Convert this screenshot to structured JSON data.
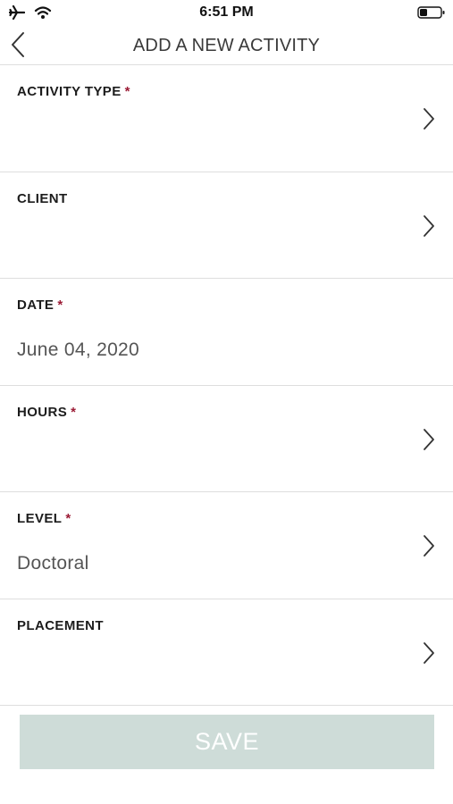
{
  "status_bar": {
    "time": "6:51 PM",
    "icons": [
      "airplane-icon",
      "wifi-icon",
      "battery-icon"
    ]
  },
  "nav": {
    "title": "ADD A NEW ACTIVITY",
    "back_icon": "chevron-left-icon"
  },
  "form": {
    "required_marker": "*",
    "rows": [
      {
        "label": "ACTIVITY TYPE",
        "required": true,
        "value": "",
        "has_chevron": true
      },
      {
        "label": "CLIENT",
        "required": false,
        "value": "",
        "has_chevron": true
      },
      {
        "label": "DATE",
        "required": true,
        "value": "June 04, 2020",
        "has_chevron": false
      },
      {
        "label": "HOURS",
        "required": true,
        "value": "",
        "has_chevron": true
      },
      {
        "label": "LEVEL",
        "required": true,
        "value": "Doctoral",
        "has_chevron": true
      },
      {
        "label": "PLACEMENT",
        "required": false,
        "value": "",
        "has_chevron": true
      }
    ]
  },
  "actions": {
    "save_label": "SAVE"
  },
  "colors": {
    "required": "#9b1b35",
    "save_button_bg": "#cedcd8",
    "divider": "#dedede"
  }
}
